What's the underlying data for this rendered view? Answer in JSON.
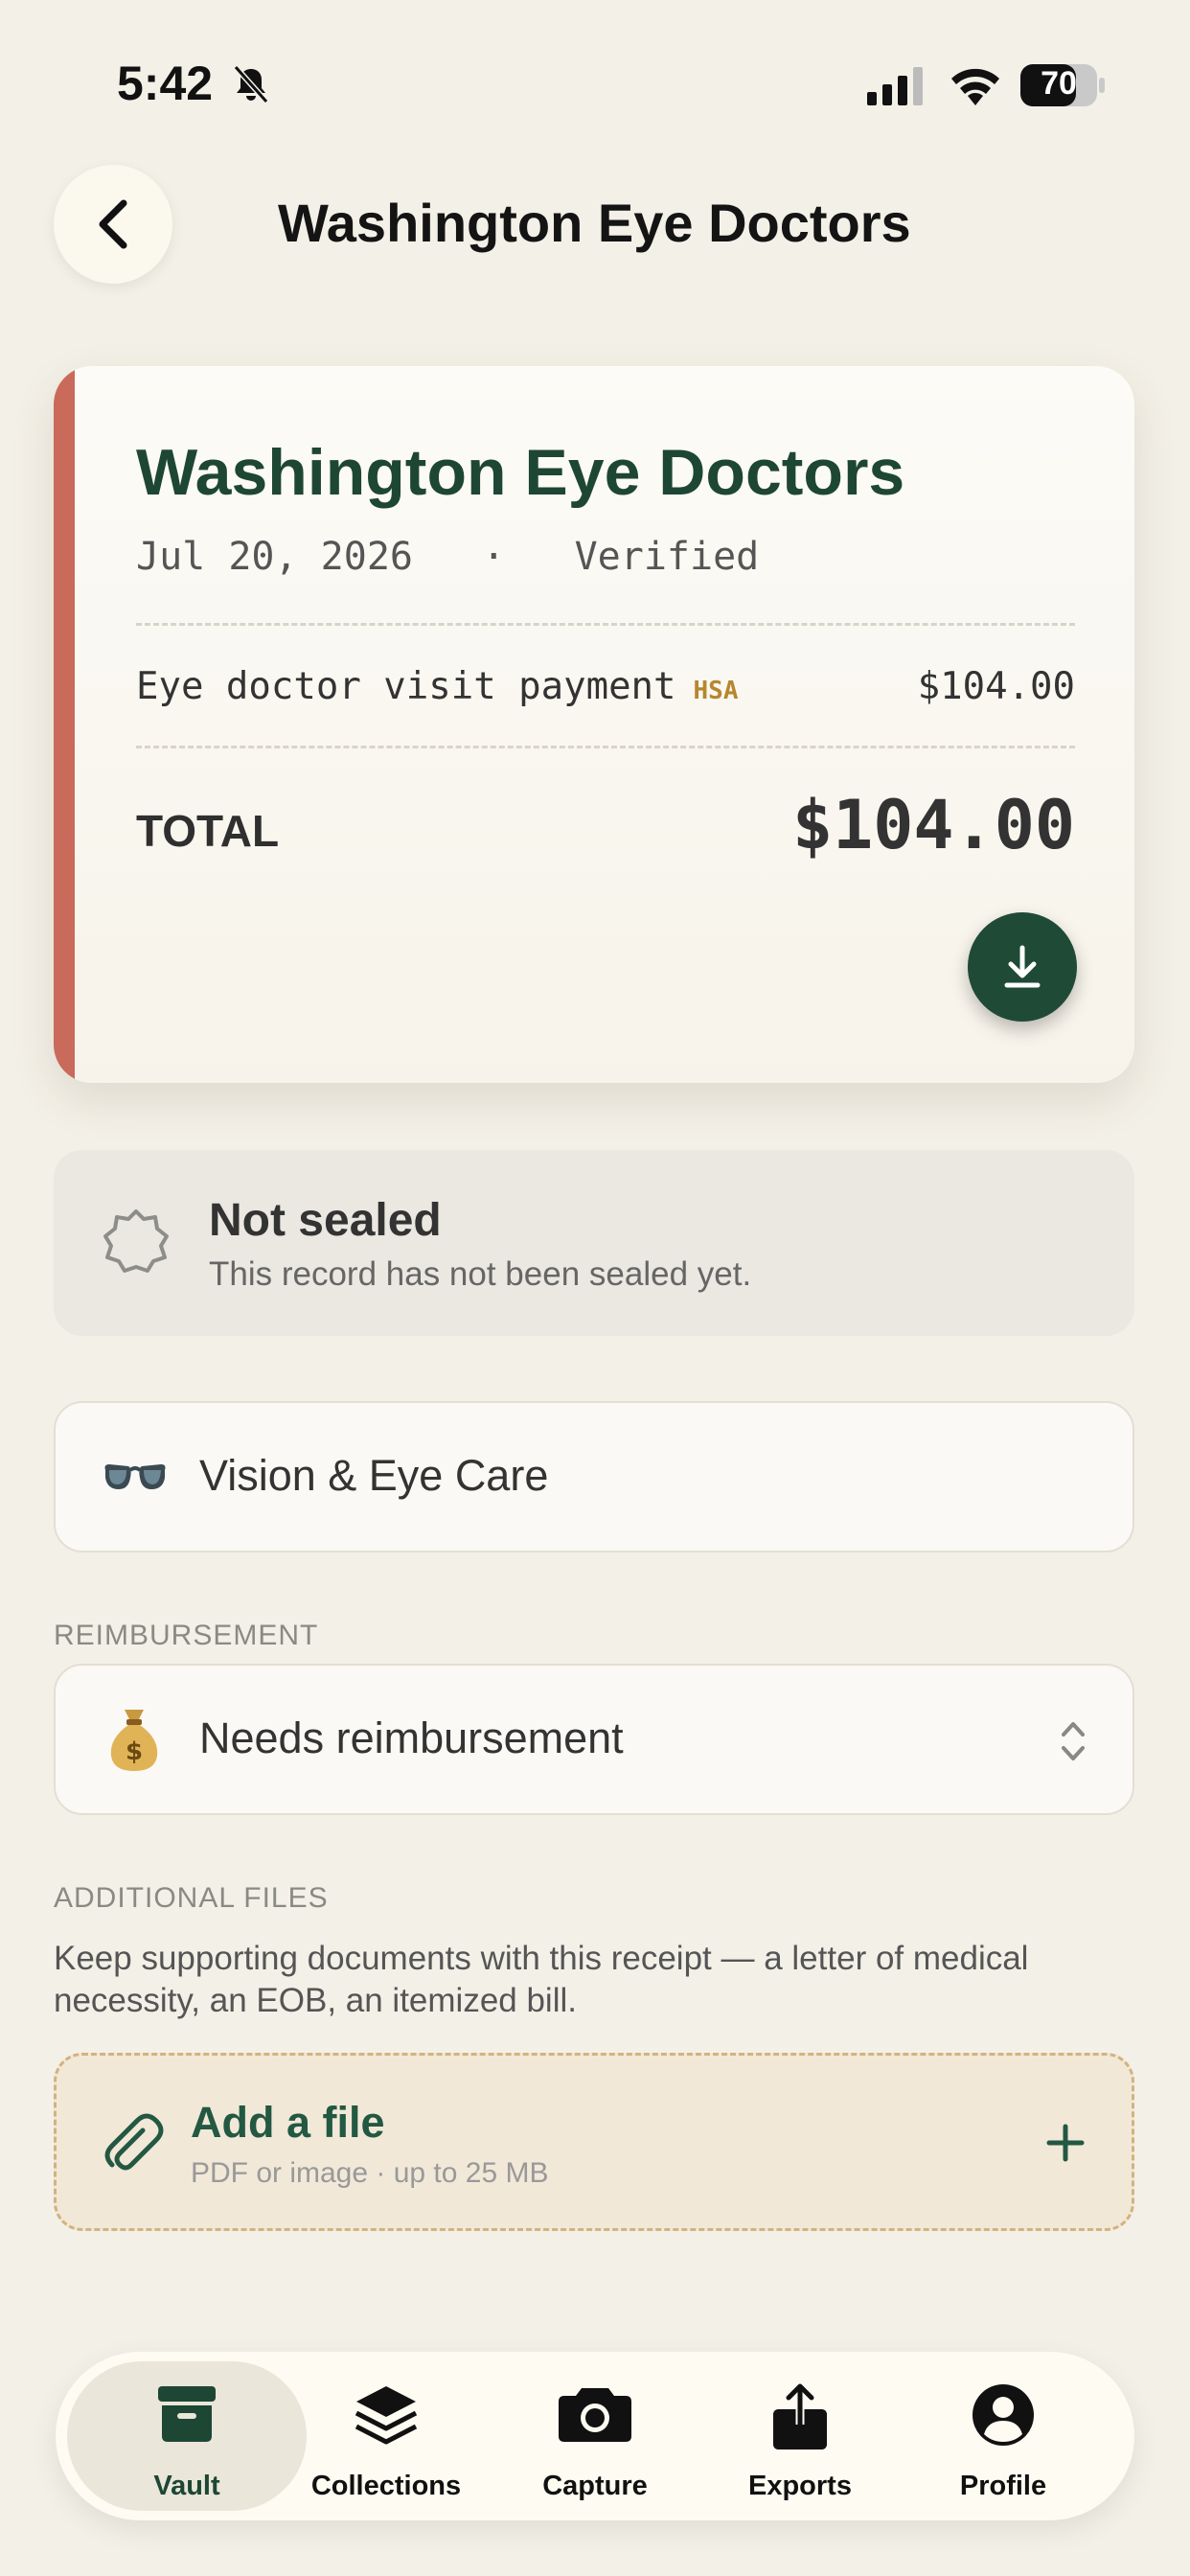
{
  "status_bar": {
    "time": "5:42",
    "battery": "70"
  },
  "header": {
    "title": "Washington Eye Doctors"
  },
  "receipt": {
    "vendor": "Washington Eye Doctors",
    "date": "Jul 20, 2026",
    "separator": "·",
    "status": "Verified",
    "line_item": {
      "description": "Eye doctor visit payment",
      "tag": "HSA",
      "amount": "$104.00"
    },
    "total_label": "TOTAL",
    "total_value": "$104.00",
    "accent_color": "#C96A5A"
  },
  "seal": {
    "title": "Not sealed",
    "subtitle": "This record has not been sealed yet."
  },
  "category": {
    "emoji": "glasses-icon",
    "label": "Vision & Eye Care"
  },
  "reimbursement": {
    "section_label": "REIMBURSEMENT",
    "emoji": "money-bag-icon",
    "value": "Needs reimbursement"
  },
  "additional_files": {
    "section_label": "ADDITIONAL FILES",
    "description": "Keep supporting documents with this receipt — a letter of medical necessity, an EOB, an itemized bill.",
    "add_title": "Add a file",
    "add_subtitle": "PDF or image · up to 25 MB"
  },
  "tab_bar": {
    "tabs": [
      {
        "label": "Vault",
        "icon": "archive-box-icon",
        "active": true
      },
      {
        "label": "Collections",
        "icon": "layers-icon",
        "active": false
      },
      {
        "label": "Capture",
        "icon": "camera-icon",
        "active": false
      },
      {
        "label": "Exports",
        "icon": "share-icon",
        "active": false
      },
      {
        "label": "Profile",
        "icon": "profile-icon",
        "active": false
      }
    ]
  },
  "colors": {
    "brand_green": "#1E4634",
    "background": "#F3F0E7",
    "hsa_tag": "#B7862E"
  }
}
